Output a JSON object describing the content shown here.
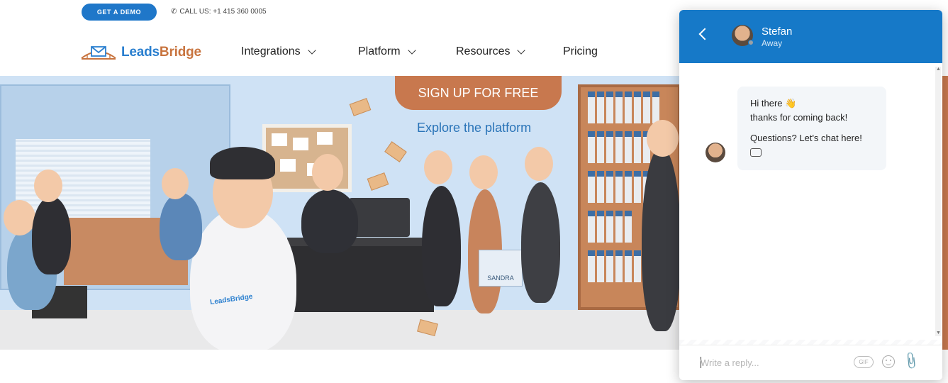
{
  "topbar": {
    "demo_label": "GET A DEMO",
    "call_label": "CALL US: +1 415 360 0005"
  },
  "nav": {
    "logo": {
      "leads": "Leads",
      "bridge": "Bridge"
    },
    "items": [
      {
        "label": "Integrations",
        "has_dropdown": true
      },
      {
        "label": "Platform",
        "has_dropdown": true
      },
      {
        "label": "Resources",
        "has_dropdown": true
      },
      {
        "label": "Pricing",
        "has_dropdown": false
      }
    ]
  },
  "hero": {
    "signup_label": "SIGN UP FOR FREE",
    "explore_label": "Explore the platform",
    "shirt_logo": "LeadsBridge",
    "bag_text": "SANDRA"
  },
  "chat": {
    "agent_name": "Stefan",
    "agent_status": "Away",
    "messages": [
      {
        "line1": "Hi there 👋",
        "line2": "thanks for coming back!",
        "line3": "Questions? Let's chat here!"
      }
    ],
    "reply_placeholder": "Write a reply...",
    "gif_label": "GIF"
  },
  "colors": {
    "brand_blue": "#1f77c9",
    "chat_header": "#1679c8",
    "signup_orange": "#c8784e",
    "logo_orange": "#c8743f"
  },
  "icons": [
    "phone-icon",
    "chevron-down-icon",
    "back-icon",
    "chat-icon",
    "emoji-icon",
    "attach-icon"
  ]
}
